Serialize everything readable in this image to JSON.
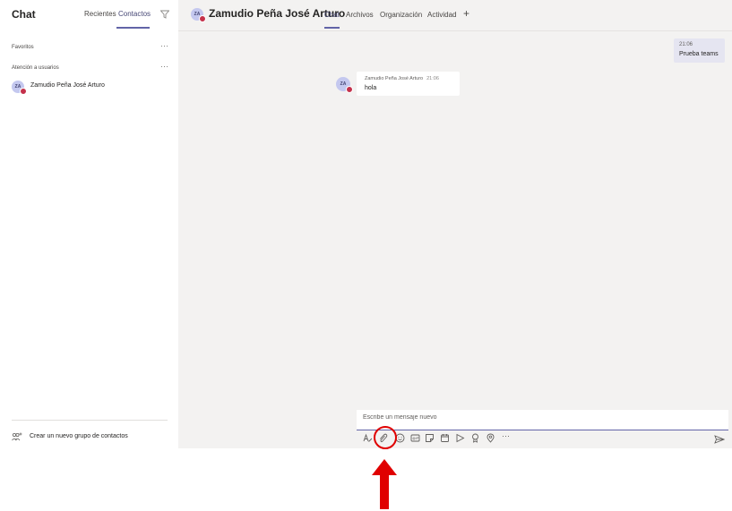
{
  "sidebar": {
    "title": "Chat",
    "tabs": [
      {
        "label": "Recientes"
      },
      {
        "label": "Contactos"
      }
    ],
    "sections": [
      {
        "label": "Favoritos",
        "more": "···"
      },
      {
        "label": "Atención a usuarios",
        "more": "···"
      }
    ],
    "contacts": [
      {
        "initials": "ZA",
        "name": "Zamudio Peña José Arturo"
      }
    ],
    "new_group_label": "Crear un nuevo grupo de contactos"
  },
  "header": {
    "initials": "ZA",
    "name": "Zamudio Peña José Arturo",
    "tabs": [
      {
        "label": "Chat"
      },
      {
        "label": "Archivos"
      },
      {
        "label": "Organización"
      },
      {
        "label": "Actividad"
      }
    ],
    "add": "+"
  },
  "messages": {
    "outgoing": {
      "time": "21:06",
      "text": "Prueba teams"
    },
    "incoming": {
      "initials": "ZA",
      "sender": "Zamudio Peña José Arturo",
      "time": "21:06",
      "text": "hola"
    }
  },
  "compose": {
    "placeholder": "Escribe un mensaje nuevo",
    "more": "···"
  },
  "colors": {
    "accent": "#6264a7",
    "presence_busy": "#c4314b",
    "annotation": "#e00000"
  },
  "icons": [
    "filter-icon",
    "group-add-icon",
    "format-icon",
    "attach-icon",
    "emoji-icon",
    "gif-icon",
    "sticker-icon",
    "meet-icon",
    "stream-icon",
    "praise-icon",
    "location-icon",
    "more-icon",
    "send-icon"
  ]
}
